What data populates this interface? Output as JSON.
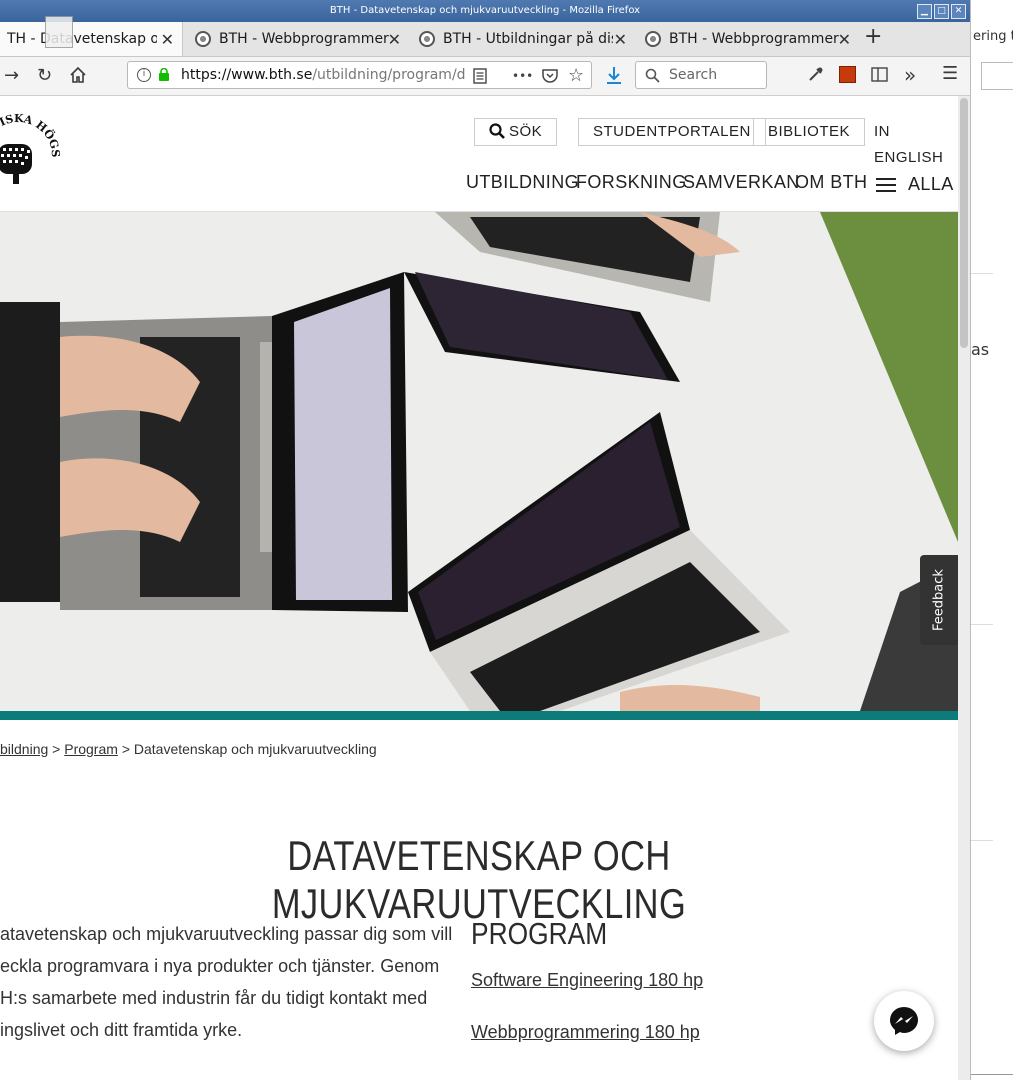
{
  "window": {
    "title": "BTH - Datavetenskap och mjukvaruutveckling - Mozilla Firefox",
    "min": "▁",
    "max": "□",
    "close": "✕"
  },
  "tabs": [
    {
      "label": "TH - Datavetenskap och",
      "close": "✕"
    },
    {
      "label": "BTH - Webbprogrammering",
      "close": "✕"
    },
    {
      "label": "BTH - Utbildningar på distans",
      "close": "✕"
    },
    {
      "label": "BTH - Webbprogrammering",
      "close": "✕"
    }
  ],
  "newtab": "+",
  "nav": {
    "url_domain": "https://www.bth.se",
    "url_path": "/utbildning/program/d",
    "search_placeholder": "Search",
    "more": "•••",
    "overflow": "»",
    "menu": "☰"
  },
  "sidestrip": {
    "tab_text": "ering t",
    "text": "as"
  },
  "site": {
    "util": {
      "search": "SÖK",
      "portal": "STUDENTPORTALEN",
      "library": "BIBLIOTEK",
      "english": "IN ENGLISH"
    },
    "main_nav": {
      "education": "UTBILDNING",
      "research": "FORSKNING",
      "collaboration": "SAMVERKAN",
      "about": "OM BTH",
      "all": "ALLA"
    },
    "logo_text": "TEKNISKA HÖGSKOLA BTH",
    "breadcrumb": {
      "first": "bildning",
      "sep1": ">",
      "second": "Program",
      "sep2": ">",
      "current": "Datavetenskap och mjukvaruutveckling"
    },
    "heading": "DATAVETENSKAP OCH MJUKVARUUTVECKLING",
    "intro_lines": [
      "atavetenskap och mjukvaruutveckling passar dig som vill",
      "eckla programvara i nya produkter och tjänster. Genom",
      "H:s samarbete med industrin får du tidigt kontakt med",
      "ingslivet och ditt framtida yrke."
    ],
    "program_heading": "PROGRAM",
    "programs": [
      "Software Engineering 180 hp",
      "Webbprogrammering 180 hp"
    ],
    "feedback": "Feedback"
  },
  "colors": {
    "teal": "#0c7c7a",
    "titlebar": "#3a649c",
    "download": "#1a86d8"
  }
}
